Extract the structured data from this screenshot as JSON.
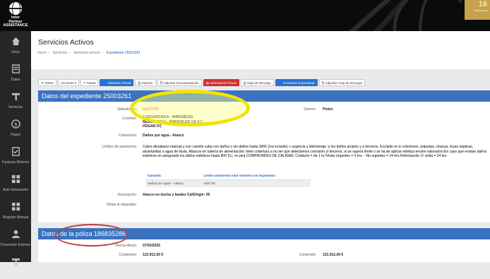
{
  "brand": {
    "line1": "Inter",
    "line2": "Partner",
    "line3": "ASSISTANCE"
  },
  "top_badge": {
    "number": "16",
    "text": "servicios ca"
  },
  "sidebar": {
    "items": [
      {
        "label": "Inicio",
        "icon": "home-icon"
      },
      {
        "label": "Datos",
        "icon": "database-icon"
      },
      {
        "label": "Servicios",
        "icon": "wrench-icon"
      },
      {
        "label": "Pagos",
        "icon": "dollar-icon"
      },
      {
        "label": "Facturas Retorno",
        "icon": "document-check-icon"
      },
      {
        "label": "Auto facturación",
        "icon": "grid-icon"
      },
      {
        "label": "Registro Manual",
        "icon": "grid-icon"
      },
      {
        "label": "Proveedor Externo",
        "icon": "user-icon"
      },
      {
        "label": "",
        "icon": "wrench-icon"
      }
    ]
  },
  "header": {
    "title": "Servicios Activos",
    "breadcrumb": [
      "Inicio",
      "Servicios",
      "Servicios activos",
      "Expediente 25003261"
    ]
  },
  "toolbar": {
    "volver": "Volver",
    "acciones": "Acciones ▾",
    "notas": "Notas",
    "asistente": "Asistente Virtual",
    "imprimir": "Imprimir",
    "adjuntar_doc": "Adjuntar Documentación",
    "info_fiscal": "Información Fiscal",
    "hoja_encargo": "Hoja de Encargo",
    "contactos": "Contactos Expediente",
    "adjuntar_hoja": "Adjuntar Hoja de Encargo"
  },
  "expediente": {
    "title": "Datos del expediente 25003261",
    "siniestro_label": "Siniestro de:",
    "siniestro_value": "GESTIÓN",
    "gremio_label": "Gremio:",
    "gremio_value": "Pintor",
    "contrato_label": "Contrato:",
    "contrato_lines": [
      "3 SEGURCAIXA - INMUEBLES",
      "SEGURCAIXA - INMUEBLES (18-S.C.",
      "HOGAR IV)"
    ],
    "coberturas_label": "Coberturas:",
    "coberturas_value": "Daños por agua - Atasco",
    "limites_label": "Límites de autonomía:",
    "limites_text": "Cubre desatasco manual y con camión cuba con daños y sin daños hasta 300€ (Iva incluido) + urgencia y kilometraje ;y los daños propios y a terceros. Excluido el or colectores, arquetas, cloacas, fosas sépticas, alcantarillas o agua de lluvia. Atascos en tubería de alimentación: tiene cobertura a no ser que detectemos corrosión y/ terceros, si se supera límite o se ha de aplicar estética envíen valoración.En caso que existan daños estéticos en asegurado los daños estéticos hasta 800 €).i, en perj COMPROMISO DE CALIDAD: Contacto = de 1 hr./Visita Urgentes = 3 hrs. - No urgentes = 24 hrs./Información 1ª visita = 24 hrs",
    "table_headers": [
      "Garantía",
      "Límite autonomía total siniestro sin impuestos"
    ],
    "table_rows": [
      [
        "Daños por agua - Atasco",
        "1487,60"
      ]
    ],
    "descripcion_label": "Descripción:",
    "descripcion_value": "Atasco en ducha y lavabo CallOrigin: 05",
    "notas_label": "Notas al reparador:"
  },
  "poliza": {
    "title": "Datos de la póliza 186835286",
    "fecha_label": "Fecha efecto:",
    "fecha_value": "07/02/2025",
    "continente_label": "Continente:",
    "continente_value": "123.912,00 €",
    "contenido_label": "Contenido:",
    "contenido_value": "123.912,00 €"
  },
  "colors": {
    "primary": "#3a72c0",
    "button_blue": "#2871d0",
    "button_red": "#d22f2f",
    "highlight_yellow": "#f2e300",
    "highlight_red": "#b8443f"
  }
}
